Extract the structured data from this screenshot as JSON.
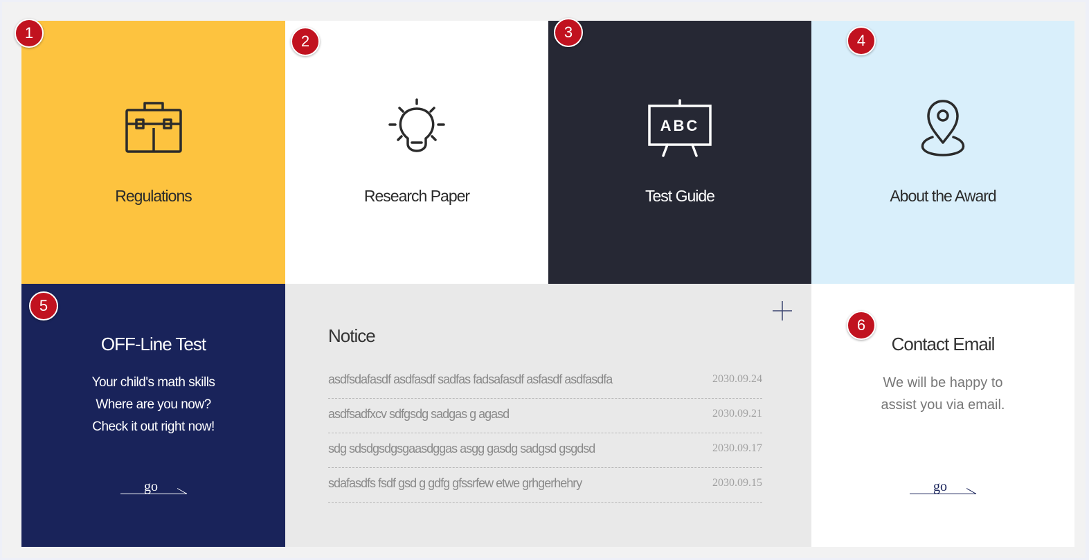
{
  "badges": [
    "1",
    "2",
    "3",
    "4",
    "5",
    "6"
  ],
  "tiles": {
    "regulations": {
      "label": "Regulations",
      "icon": "briefcase-icon",
      "bg": "#fdc33f"
    },
    "research": {
      "label": "Research Paper",
      "icon": "lightbulb-icon",
      "bg": "#ffffff"
    },
    "test_guide": {
      "label": "Test Guide",
      "icon": "chalkboard-icon",
      "icon_text": "ABC",
      "bg": "#262834"
    },
    "award": {
      "label": "About the Award",
      "icon": "location-pin-icon",
      "bg": "#d9effb"
    }
  },
  "offline": {
    "title": "OFF-Line Test",
    "lines": [
      "Your child's math skills",
      "Where are you now?",
      "Check it out right now!"
    ],
    "go": "go",
    "bg": "#19235a"
  },
  "notice": {
    "title": "Notice",
    "more_icon": "plus-icon",
    "items": [
      {
        "text": "asdfsdafasdf asdfasdf sadfas fadsafasdf asfasdf asdfasdfa",
        "date": "2030.09.24"
      },
      {
        "text": "asdfsadfxcv sdfgsdg sadgas g agasd",
        "date": "2030.09.21"
      },
      {
        "text": "sdg sdsdgsdgsgaasdggas asgg  gasdg sadgsd  gsgdsd",
        "date": "2030.09.17"
      },
      {
        "text": "sdafasdfs fsdf gsd g gdfg gfssrfew etwe grhgerhehry",
        "date": "2030.09.15"
      }
    ]
  },
  "contact": {
    "title": "Contact Email",
    "lines": [
      "We will be happy to",
      "assist you via email."
    ],
    "go": "go"
  }
}
